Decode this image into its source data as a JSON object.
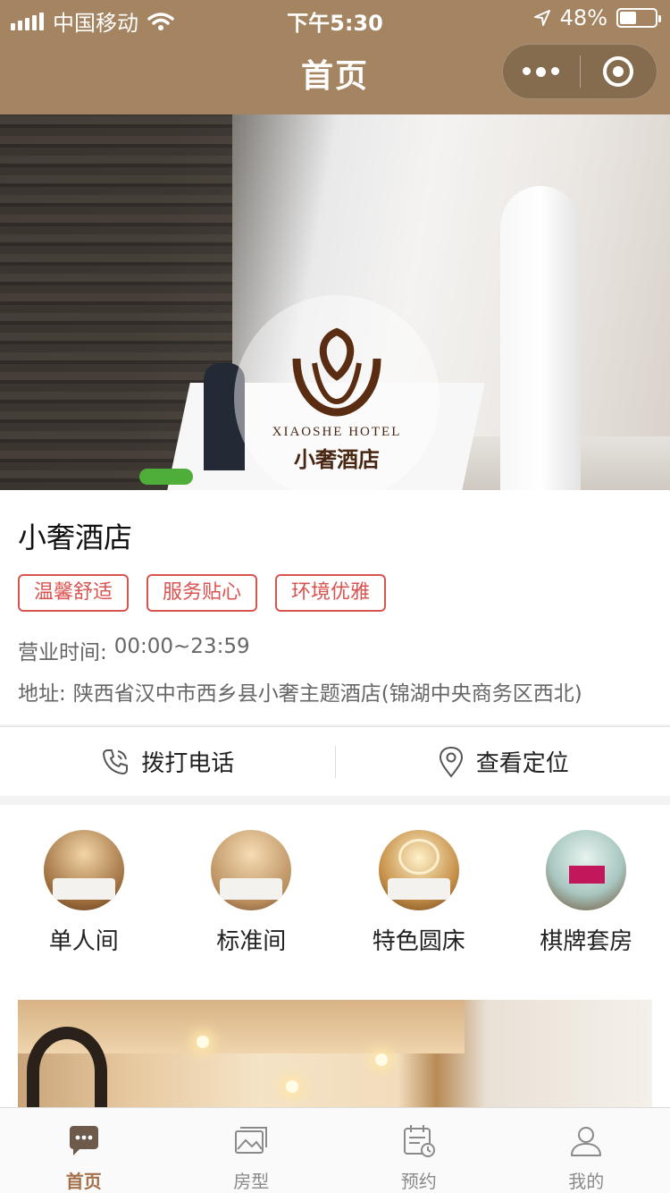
{
  "status_bar": {
    "carrier": "中国移动",
    "time": "下午5:30",
    "battery": "48%",
    "battery_level": 0.48
  },
  "nav": {
    "title": "首页",
    "more_icon": "more-dots-icon",
    "home_icon": "capsule-home-icon"
  },
  "banner": {
    "logo_en": "XIAOSHE HOTEL",
    "logo_cn": "小奢酒店",
    "slide_count": 3,
    "active_slide": 1
  },
  "hotel": {
    "name": "小奢酒店",
    "tags": [
      "温馨舒适",
      "服务贴心",
      "环境优雅"
    ],
    "hours_label": "营业时间:",
    "hours_value": "00:00~23:59",
    "address_label": "地址:",
    "address_value": "陕西省汉中市西乡县小奢主题酒店(锦湖中央商务区西北)"
  },
  "actions": {
    "call": "拨打电话",
    "location": "查看定位"
  },
  "room_categories": [
    {
      "label": "单人间"
    },
    {
      "label": "标准间"
    },
    {
      "label": "特色圆床"
    },
    {
      "label": "棋牌套房"
    }
  ],
  "tabbar": {
    "items": [
      {
        "label": "首页",
        "icon": "chat-bubble-icon",
        "active": true
      },
      {
        "label": "房型",
        "icon": "gallery-icon",
        "active": false
      },
      {
        "label": "预约",
        "icon": "calendar-icon",
        "active": false
      },
      {
        "label": "我的",
        "icon": "user-icon",
        "active": false
      }
    ]
  },
  "colors": {
    "nav_bg": "#a48461",
    "tag_red": "#d9534f",
    "tab_active": "#a4704a",
    "tab_inactive": "#8a8a8a"
  }
}
